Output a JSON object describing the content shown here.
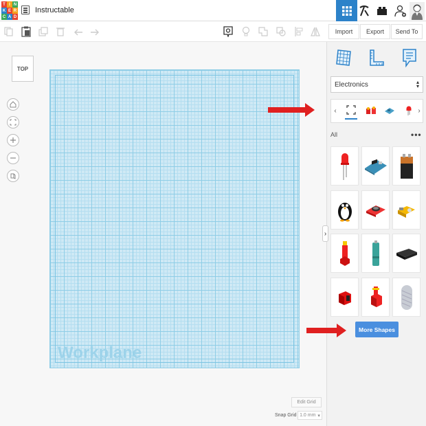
{
  "header": {
    "logo_letters": [
      "TIN",
      "KER",
      "CAD"
    ],
    "project_title": "Instructable"
  },
  "toolbar": {
    "import_label": "Import",
    "export_label": "Export",
    "send_to_label": "Send To"
  },
  "workspace": {
    "view_cube_label": "TOP",
    "workplane_label": "Workplane",
    "edit_grid_label": "Edit Grid",
    "snap_grid_label": "Snap Grid",
    "snap_grid_value": "1.0 mm"
  },
  "panel": {
    "library_selected": "Electronics",
    "shapes_header": "All",
    "more_shapes_label": "More Shapes"
  },
  "colors": {
    "accent_blue": "#2c82c9",
    "button_blue": "#4a8fdf",
    "annotation_red": "#e02020",
    "workplane_blue": "#cfe9f5"
  }
}
